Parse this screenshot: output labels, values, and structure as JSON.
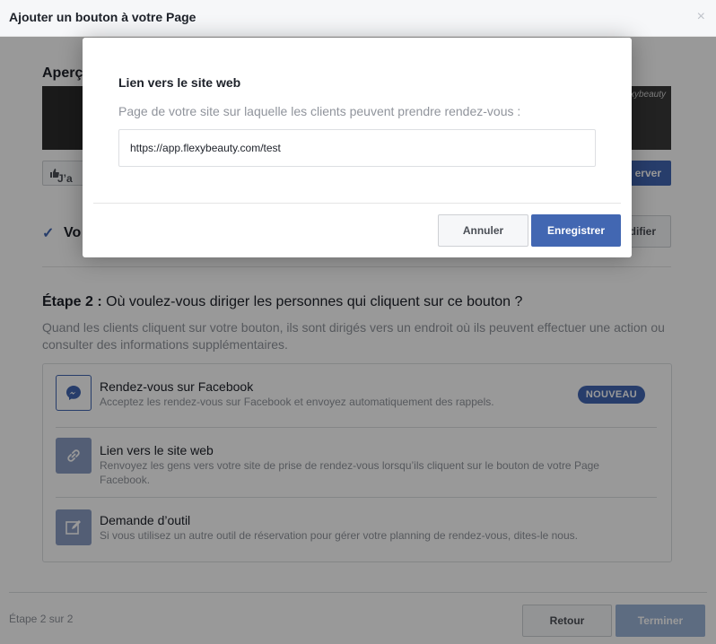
{
  "dialog": {
    "title": "Ajouter un bouton à votre Page",
    "close_glyph": "×"
  },
  "background": {
    "preview_title": "Aperç",
    "preview_brand": "flexybeauty",
    "like_label": "J’a",
    "reserve_label": "erver",
    "step1_label": "Vo",
    "modify_label": "difier"
  },
  "step2": {
    "title_prefix": "Étape 2 :",
    "title_text": " Où voulez-vous diriger les personnes qui cliquent sur ce bouton ?",
    "description": "Quand les clients cliquent sur votre bouton, ils sont dirigés vers un endroit où ils peuvent effectuer une action ou consulter des informations supplémentaires."
  },
  "options": [
    {
      "title": "Rendez-vous sur Facebook",
      "description": "Acceptez les rendez-vous sur Facebook et envoyez automatiquement des rappels.",
      "badge": "NOUVEAU",
      "icon": "messenger-icon"
    },
    {
      "title": "Lien vers le site web",
      "description": "Renvoyez les gens vers votre site de prise de rendez-vous lorsqu’ils cliquent sur le bouton de votre Page Facebook.",
      "icon": "link-icon"
    },
    {
      "title": "Demande d’outil",
      "description": "Si vous utilisez un autre outil de réservation pour gérer votre planning de rendez-vous, dites-le nous.",
      "icon": "edit-icon"
    }
  ],
  "footer": {
    "step_indicator": "Étape 2 sur 2",
    "back_label": "Retour",
    "finish_label": "Terminer"
  },
  "modal": {
    "title": "Lien vers le site web",
    "subtitle": "Page de votre site sur laquelle les clients peuvent prendre rendez-vous :",
    "url_value": "https://app.flexybeauty.com/test",
    "cancel_label": "Annuler",
    "save_label": "Enregistrer"
  },
  "colors": {
    "accent": "#4267b2",
    "disabled_accent": "#9cb4d8",
    "icon_bg": "#8b9dc3"
  }
}
